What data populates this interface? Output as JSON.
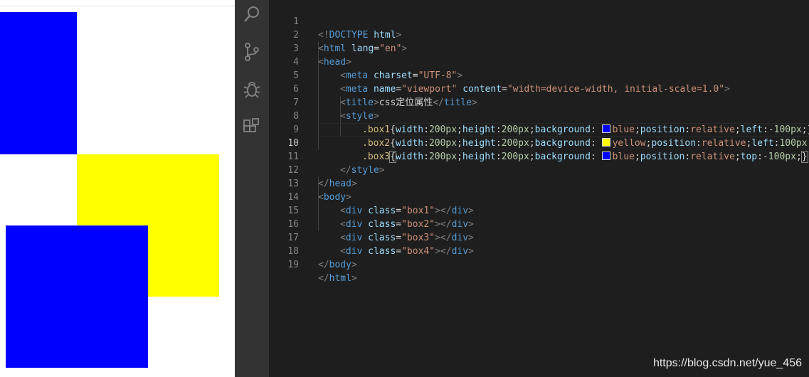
{
  "preview": {
    "boxes": [
      {
        "name": "box1",
        "color": "#0000ff"
      },
      {
        "name": "box2",
        "color": "#ffff00"
      },
      {
        "name": "box3",
        "color": "#0000ff"
      }
    ]
  },
  "activity_bar": {
    "icons": [
      "search-icon",
      "source-control-icon",
      "debug-icon",
      "extensions-icon"
    ]
  },
  "editor": {
    "line_numbers": [
      "1",
      "2",
      "3",
      "4",
      "5",
      "6",
      "7",
      "8",
      "9",
      "10",
      "11",
      "12",
      "13",
      "14",
      "15",
      "16",
      "17",
      "18",
      "19"
    ],
    "lines": {
      "l1": {
        "a": "<!",
        "b": "DOCTYPE",
        "c": " html",
        "d": ">"
      },
      "l2": {
        "a": "<",
        "b": "html",
        "c": " lang",
        "d": "=",
        "e": "\"en\"",
        "f": ">"
      },
      "l3": {
        "a": "<",
        "b": "head",
        "c": ">"
      },
      "l4": {
        "a": "<",
        "b": "meta",
        "c": " charset",
        "d": "=",
        "e": "\"UTF-8\"",
        "f": ">"
      },
      "l5": {
        "a": "<",
        "b": "meta",
        "c": " name",
        "d": "=",
        "e": "\"viewport\"",
        "f": " content",
        "g": "=",
        "h": "\"width=device-width, initial-scale=1.0\"",
        "i": ">"
      },
      "l6": {
        "a": "<",
        "b": "title",
        "c": ">",
        "d": "css定位属性",
        "e": "</",
        "f": "title",
        "g": ">"
      },
      "l7": {
        "a": "<",
        "b": "style",
        "c": ">"
      },
      "l8": {
        "sel": ".box1",
        "o": "{",
        "p1": "width",
        "v1": "200px",
        "p2": "height",
        "v2": "200px",
        "p3": "background",
        "v3": "blue",
        "p4": "position",
        "v4": "relative",
        "p5": "left",
        "v5": "-100px",
        "c": "}"
      },
      "l9": {
        "sel": ".box2",
        "o": "{",
        "p1": "width",
        "v1": "200px",
        "p2": "height",
        "v2": "200px",
        "p3": "background",
        "v3": "yellow",
        "p4": "position",
        "v4": "relative",
        "p5": "left",
        "v5": "100px",
        "c": "}"
      },
      "l10": {
        "sel": ".box3",
        "o": "{",
        "p1": "width",
        "v1": "200px",
        "p2": "height",
        "v2": "200px",
        "p3": "background",
        "v3": "blue",
        "p4": "position",
        "v4": "relative",
        "p5": "top",
        "v5": "-100px",
        "c": "}"
      },
      "l11": {
        "a": "</",
        "b": "style",
        "c": ">"
      },
      "l12": {
        "a": "</",
        "b": "head",
        "c": ">"
      },
      "l13": {
        "a": "<",
        "b": "body",
        "c": ">"
      },
      "l14": {
        "a": "<",
        "b": "div",
        "c": " class",
        "d": "=",
        "e": "\"box1\"",
        "f": "></",
        "g": "div",
        "h": ">"
      },
      "l15": {
        "a": "<",
        "b": "div",
        "c": " class",
        "d": "=",
        "e": "\"box2\"",
        "f": "></",
        "g": "div",
        "h": ">"
      },
      "l16": {
        "a": "<",
        "b": "div",
        "c": " class",
        "d": "=",
        "e": "\"box3\"",
        "f": "></",
        "g": "div",
        "h": ">"
      },
      "l17": {
        "a": "<",
        "b": "div",
        "c": " class",
        "d": "=",
        "e": "\"box4\"",
        "f": "></",
        "g": "div",
        "h": ">"
      },
      "l18": {
        "a": "</",
        "b": "body",
        "c": ">"
      },
      "l19": {
        "a": "</",
        "b": "html",
        "c": ">"
      }
    },
    "swatch_colors": {
      "blue": "#0000ff",
      "yellow": "#ffff00"
    }
  },
  "watermark": "https://blog.csdn.net/yue_456"
}
